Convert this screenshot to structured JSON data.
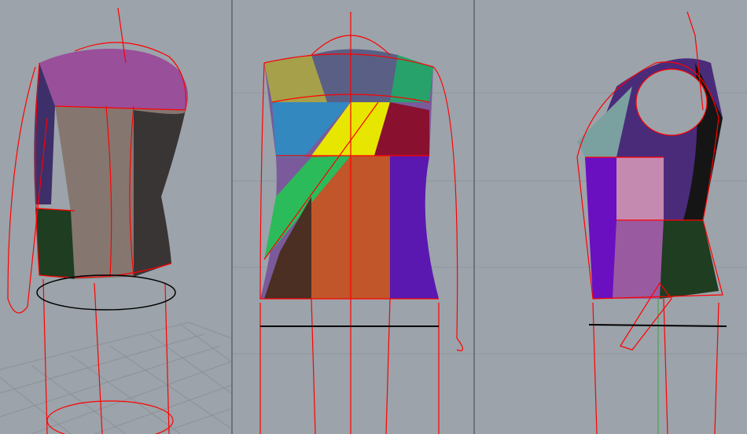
{
  "viewports": [
    {
      "id": "perspective"
    },
    {
      "id": "front"
    },
    {
      "id": "right"
    }
  ],
  "colors": {
    "background": "#9ca3aa",
    "curve": "#ff0000",
    "grid": "#8e959c",
    "separator": "#6e7379",
    "axis_green": "#3aa040"
  }
}
